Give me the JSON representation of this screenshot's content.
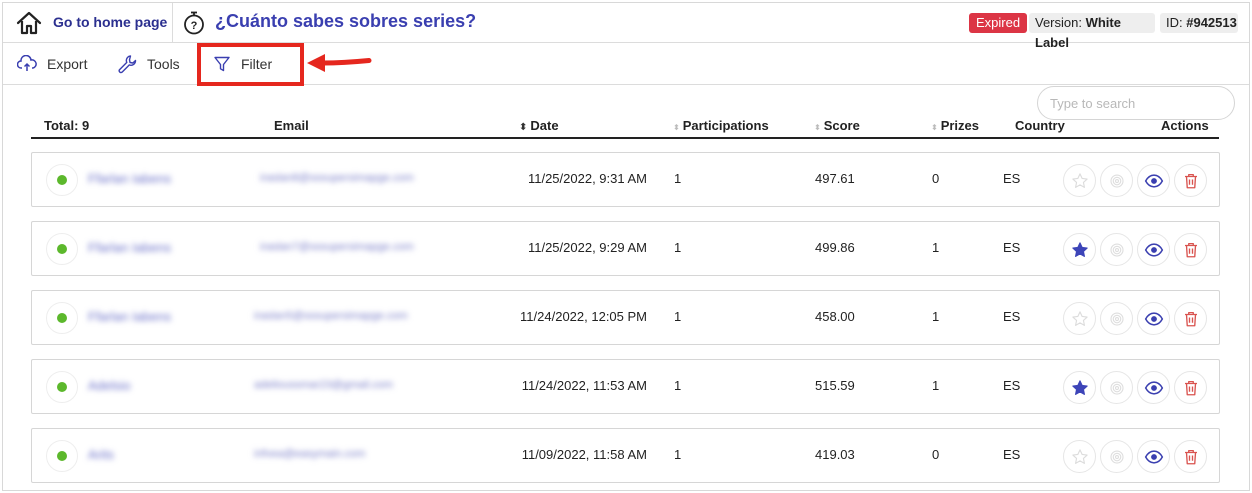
{
  "header": {
    "home_label": "Go to home page",
    "title": "¿Cuánto sabes sobres series?",
    "status_badge": "Expired",
    "version_prefix": "Version: ",
    "version_value": "White Label",
    "id_prefix": "ID: ",
    "id_value": "#942513"
  },
  "toolbar": {
    "export_label": "Export",
    "tools_label": "Tools",
    "filter_label": "Filter",
    "search_placeholder": "Type to search"
  },
  "table": {
    "total_label": "Total: 9",
    "columns": {
      "email": "Email",
      "date": "Date",
      "participations": "Participations",
      "score": "Score",
      "prizes": "Prizes",
      "country": "Country",
      "actions": "Actions"
    },
    "rows": [
      {
        "name": "Ffarlan Iabens",
        "email": "iraslan8@sssupersimapge.com",
        "date": "11/25/2022, 9:31 AM",
        "participations": "1",
        "score": "497.61",
        "prizes": "0",
        "country": "ES",
        "starred": false
      },
      {
        "name": "Ffarlan Iabens",
        "email": "iraslan7@sssupersimapge.com",
        "date": "11/25/2022, 9:29 AM",
        "participations": "1",
        "score": "499.86",
        "prizes": "1",
        "country": "ES",
        "starred": true
      },
      {
        "name": "Ffarlan Iabens",
        "email": "iraslan5@sssupersimapge.com",
        "date": "11/24/2022, 12:05 PM",
        "participations": "1",
        "score": "458.00",
        "prizes": "1",
        "country": "ES",
        "starred": false
      },
      {
        "name": "Adelsio",
        "email": "adelioussmar23@gmail.com",
        "date": "11/24/2022, 11:53 AM",
        "participations": "1",
        "score": "515.59",
        "prizes": "1",
        "country": "ES",
        "starred": true
      },
      {
        "name": "Arits",
        "email": "infvea@easymain.com",
        "date": "11/09/2022, 11:58 AM",
        "participations": "1",
        "score": "419.03",
        "prizes": "0",
        "country": "ES",
        "starred": false
      }
    ]
  },
  "colors": {
    "accent": "#3a3fb0",
    "expired": "#dc3545",
    "status_active": "#5cb82c",
    "star_active": "#3d45b8",
    "delete": "#d9534f",
    "highlight": "#e5271e"
  },
  "icons": {
    "home": "home-icon",
    "timer": "stopwatch-icon",
    "export": "cloud-upload-icon",
    "tools": "wrench-icon",
    "filter": "funnel-icon",
    "star": "star-icon",
    "prize": "medal-icon",
    "view": "eye-icon",
    "delete": "trash-icon"
  }
}
